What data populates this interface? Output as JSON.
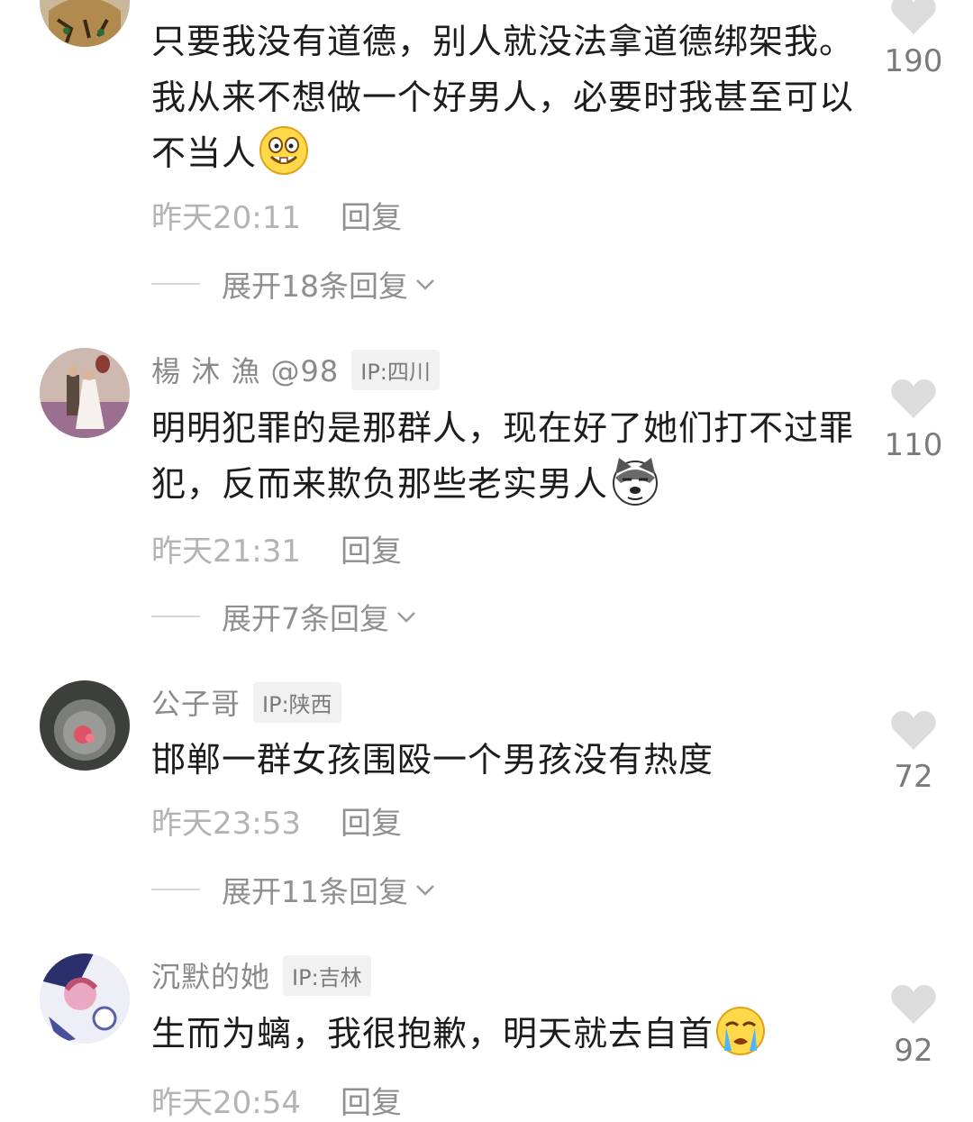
{
  "comments": [
    {
      "username": "",
      "ip": "",
      "text": "只要我没有道德，别人就没法拿道德绑架我。我从来不想做一个好男人，必要时我甚至可以不当人",
      "emoji": "grinning-emoji",
      "time": "昨天20:11",
      "reply_label": "回复",
      "expand_label": "展开18条回复",
      "likes": "190"
    },
    {
      "username": "楊 沐 漁 @98",
      "ip": "IP:四川",
      "text": "明明犯罪的是那群人，现在好了她们打不过罪犯，反而来欺负那些老实男人",
      "emoji": "dog-emoji",
      "time": "昨天21:31",
      "reply_label": "回复",
      "expand_label": "展开7条回复",
      "likes": "110"
    },
    {
      "username": "公子哥",
      "ip": "IP:陕西",
      "text": "邯郸一群女孩围殴一个男孩没有热度",
      "emoji": "",
      "time": "昨天23:53",
      "reply_label": "回复",
      "expand_label": "展开11条回复",
      "likes": "72"
    },
    {
      "username": "沉默的她",
      "ip": "IP:吉林",
      "text": "生而为螭，我很抱歉，明天就去自首",
      "emoji": "crying-emoji",
      "time": "昨天20:54",
      "reply_label": "回复",
      "expand_label": "",
      "likes": "92"
    }
  ],
  "colors": {
    "text": "#1c1c1c",
    "meta": "#8a8a8a",
    "time": "#b3b3b3",
    "heart": "#dcdcdc"
  }
}
